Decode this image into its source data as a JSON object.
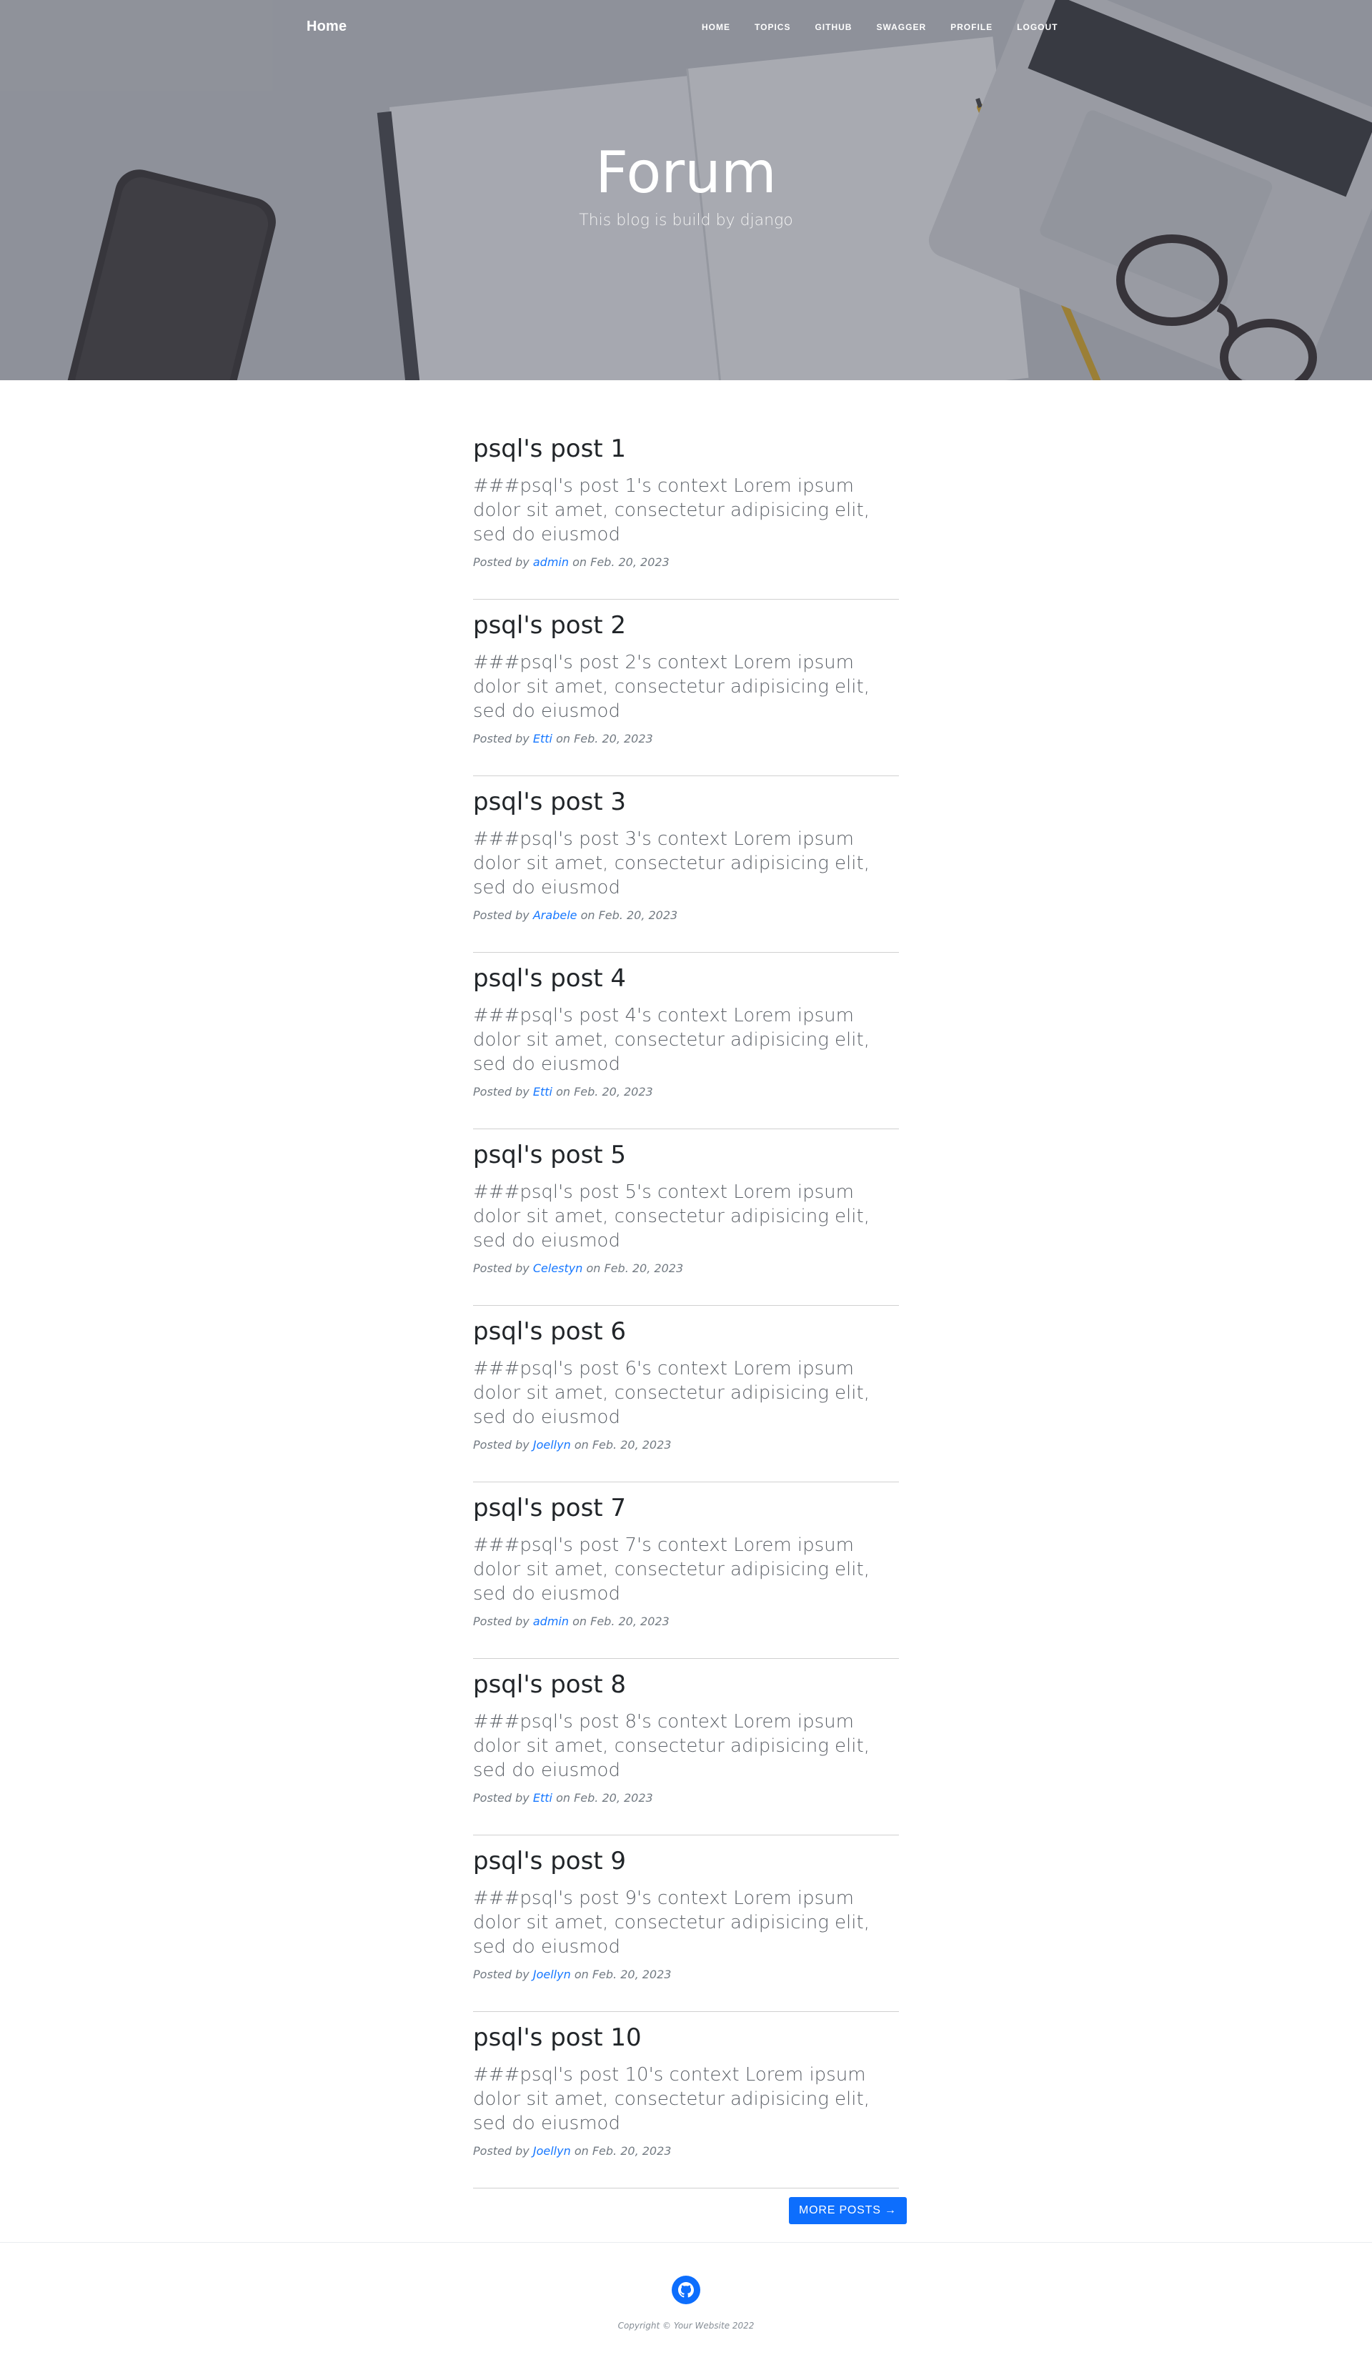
{
  "navbar": {
    "brand": "Home",
    "links": [
      "HOME",
      "TOPICS",
      "GITHUB",
      "SWAGGER",
      "PROFILE",
      "LOGOUT"
    ]
  },
  "header": {
    "title": "Forum",
    "subtitle": "This blog is build by django"
  },
  "posts": [
    {
      "title": "psql's post 1",
      "body": "###psql's post 1's context Lorem ipsum dolor sit amet, consectetur adipisicing elit, sed do eiusmod",
      "meta_prefix": "Posted by",
      "author": "admin",
      "meta_suffix": "on Feb. 20, 2023"
    },
    {
      "title": "psql's post 2",
      "body": "###psql's post 2's context Lorem ipsum dolor sit amet, consectetur adipisicing elit, sed do eiusmod",
      "meta_prefix": "Posted by",
      "author": "Etti",
      "meta_suffix": "on Feb. 20, 2023"
    },
    {
      "title": "psql's post 3",
      "body": "###psql's post 3's context Lorem ipsum dolor sit amet, consectetur adipisicing elit, sed do eiusmod",
      "meta_prefix": "Posted by",
      "author": "Arabele",
      "meta_suffix": "on Feb. 20, 2023"
    },
    {
      "title": "psql's post 4",
      "body": "###psql's post 4's context Lorem ipsum dolor sit amet, consectetur adipisicing elit, sed do eiusmod",
      "meta_prefix": "Posted by",
      "author": "Etti",
      "meta_suffix": "on Feb. 20, 2023"
    },
    {
      "title": "psql's post 5",
      "body": "###psql's post 5's context Lorem ipsum dolor sit amet, consectetur adipisicing elit, sed do eiusmod",
      "meta_prefix": "Posted by",
      "author": "Celestyn",
      "meta_suffix": "on Feb. 20, 2023"
    },
    {
      "title": "psql's post 6",
      "body": "###psql's post 6's context Lorem ipsum dolor sit amet, consectetur adipisicing elit, sed do eiusmod",
      "meta_prefix": "Posted by",
      "author": "Joellyn",
      "meta_suffix": "on Feb. 20, 2023"
    },
    {
      "title": "psql's post 7",
      "body": "###psql's post 7's context Lorem ipsum dolor sit amet, consectetur adipisicing elit, sed do eiusmod",
      "meta_prefix": "Posted by",
      "author": "admin",
      "meta_suffix": "on Feb. 20, 2023"
    },
    {
      "title": "psql's post 8",
      "body": "###psql's post 8's context Lorem ipsum dolor sit amet, consectetur adipisicing elit, sed do eiusmod",
      "meta_prefix": "Posted by",
      "author": "Etti",
      "meta_suffix": "on Feb. 20, 2023"
    },
    {
      "title": "psql's post 9",
      "body": "###psql's post 9's context Lorem ipsum dolor sit amet, consectetur adipisicing elit, sed do eiusmod",
      "meta_prefix": "Posted by",
      "author": "Joellyn",
      "meta_suffix": "on Feb. 20, 2023"
    },
    {
      "title": "psql's post 10",
      "body": "###psql's post 10's context Lorem ipsum dolor sit amet, consectetur adipisicing elit, sed do eiusmod",
      "meta_prefix": "Posted by",
      "author": "Joellyn",
      "meta_suffix": "on Feb. 20, 2023"
    }
  ],
  "pager": {
    "more_label": "MORE POSTS →"
  },
  "footer": {
    "icon": "github-icon",
    "copyright": "Copyright © Your Website 2022"
  },
  "colors": {
    "accent": "#0d6efd",
    "link": "#1677ff",
    "header_overlay": "#484c58"
  }
}
